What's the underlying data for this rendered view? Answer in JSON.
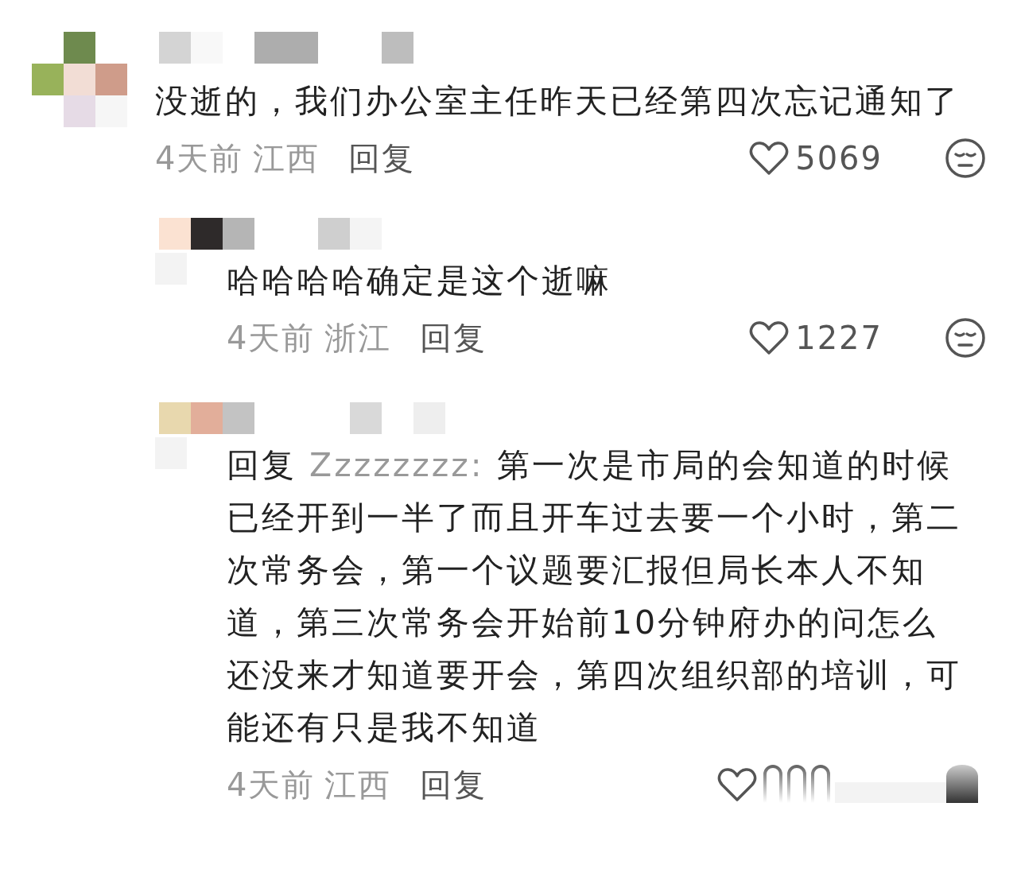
{
  "comments": [
    {
      "text": "没逝的，我们办公室主任昨天已经第四次忘记通知了",
      "time": "4天前",
      "region": "江西",
      "reply_label": "回复",
      "likes": "5069",
      "replies": [
        {
          "text": "哈哈哈哈确定是这个逝嘛",
          "time": "4天前",
          "region": "浙江",
          "reply_label": "回复",
          "likes": "1227"
        },
        {
          "reply_to_label": "回复",
          "reply_to": "Zzzzzzzz:",
          "text": "第一次是市局的会知道的时候已经开到一半了而且开车过去要一个小时，第二次常务会，第一个议题要汇报但局长本人不知道，第三次常务会开始前10分钟府办的问怎么还没来才知道要开会，第四次组织部的培训，可能还有只是我不知道",
          "time": "4天前",
          "region": "江西",
          "reply_label": "回复"
        }
      ]
    }
  ]
}
